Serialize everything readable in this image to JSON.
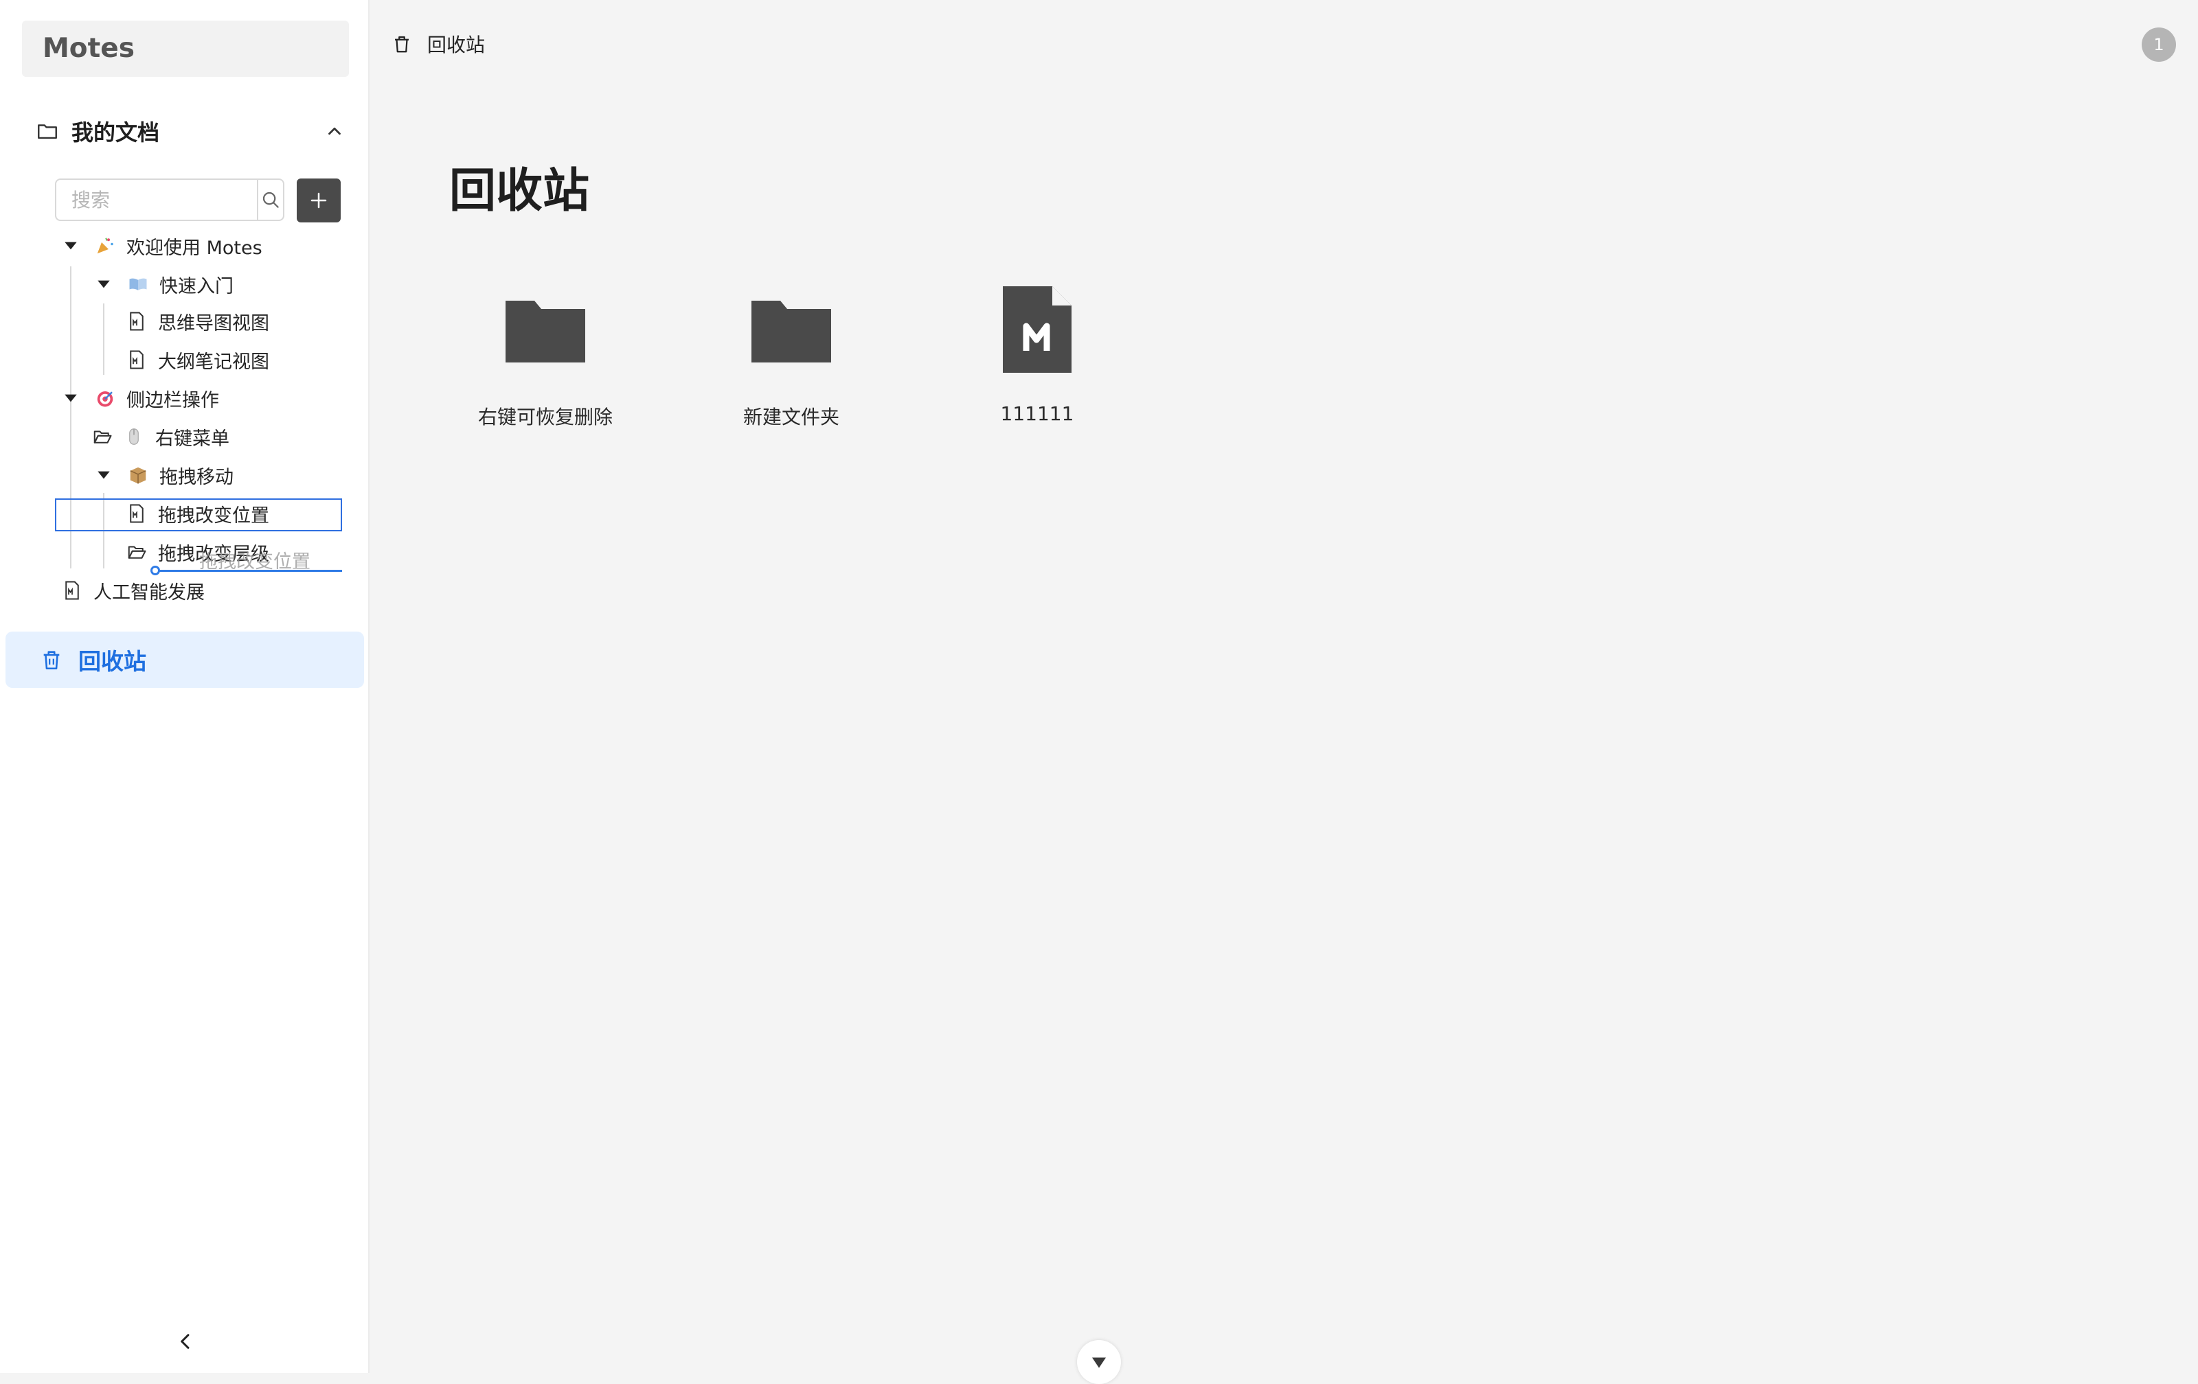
{
  "app": {
    "title": "Motes"
  },
  "sidebar": {
    "section_label": "我的文档",
    "search": {
      "placeholder": "搜索",
      "value": ""
    },
    "tree": [
      {
        "label": "欢迎使用 Motes",
        "emoji": "party-popper-icon"
      },
      {
        "label": "快速入门",
        "emoji": "open-book-icon"
      },
      {
        "label": "思维导图视图"
      },
      {
        "label": "大纲笔记视图"
      },
      {
        "label": "侧边栏操作",
        "emoji": "target-icon"
      },
      {
        "label": "右键菜单",
        "emoji": "mouse-icon"
      },
      {
        "label": "拖拽移动",
        "emoji": "package-icon"
      },
      {
        "label": "拖拽改变位置"
      },
      {
        "label": "拖拽改变层级"
      },
      {
        "label": "人工智能发展"
      }
    ],
    "drag_ghost_label": "拖拽改变位置",
    "trash_label": "回收站"
  },
  "header": {
    "breadcrumb": "回收站",
    "badge": "1"
  },
  "main": {
    "title": "回收站",
    "items": [
      {
        "name": "右键可恢复删除",
        "type": "folder"
      },
      {
        "name": "新建文件夹",
        "type": "folder"
      },
      {
        "name": "111111",
        "type": "markdown"
      }
    ]
  },
  "colors": {
    "accent": "#1e6fe0",
    "active_bg": "#e6f1ff",
    "icon_dark": "#4a4a4a"
  }
}
